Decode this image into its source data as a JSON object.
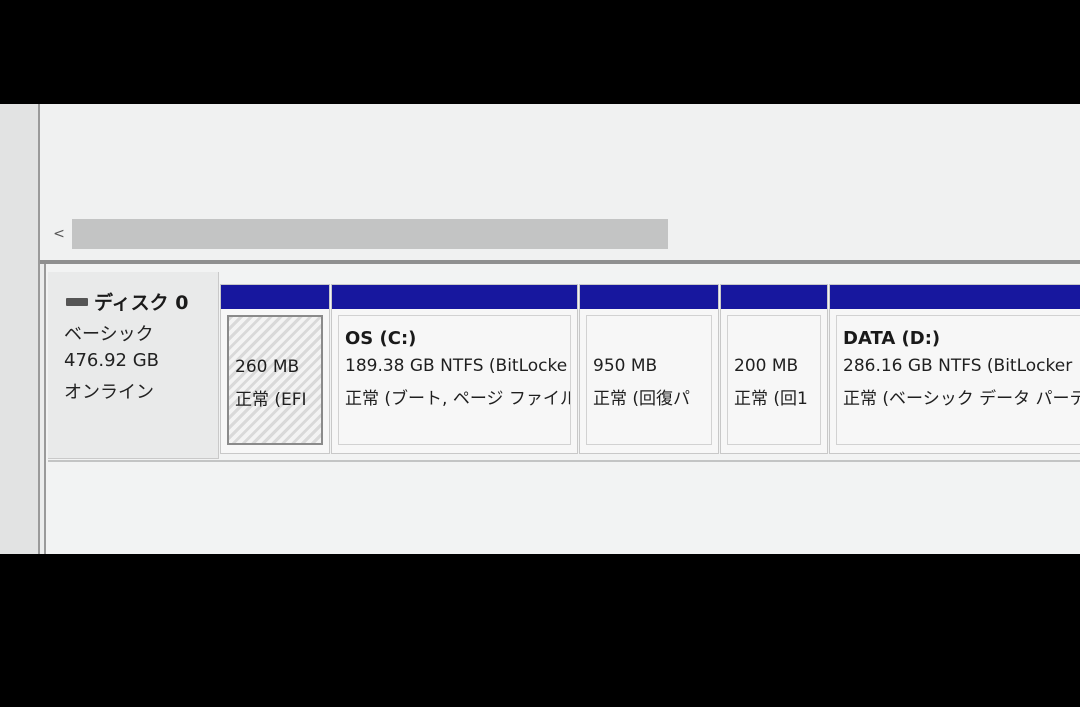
{
  "disk": {
    "title": "ディスク 0",
    "type": "ベーシック",
    "size": "476.92 GB",
    "status": "オンライン",
    "icon": "disk-icon"
  },
  "scroll": {
    "left_arrow": "<"
  },
  "partitions": [
    {
      "name": "",
      "size": "260 MB",
      "status": "正常 (EFI"
    },
    {
      "name": "OS  (C:)",
      "size": "189.38 GB NTFS (BitLocke",
      "status": "正常 (ブート, ページ ファイル,"
    },
    {
      "name": "",
      "size": "950 MB",
      "status": "正常 (回復パ"
    },
    {
      "name": "",
      "size": "200 MB",
      "status": "正常 (回1"
    },
    {
      "name": "DATA  (D:)",
      "size": "286.16 GB NTFS (BitLocker",
      "status": "正常 (ベーシック データ パーティ"
    }
  ],
  "colors": {
    "partition_header": "#17179e",
    "background": "#eceded"
  }
}
